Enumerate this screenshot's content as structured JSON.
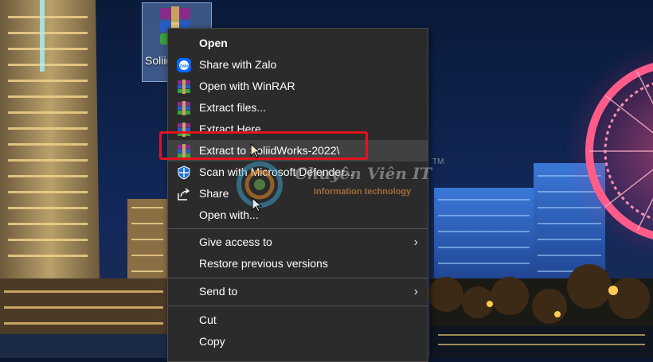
{
  "desktop": {
    "file_icon": {
      "name": "Soliid",
      "icon": "winrar-archive-icon"
    }
  },
  "context_menu": {
    "items": [
      {
        "label": "Open",
        "icon": "none",
        "bold": true
      },
      {
        "label": "Share with Zalo",
        "icon": "zalo-icon"
      },
      {
        "label": "Open with WinRAR",
        "icon": "winrar-icon"
      },
      {
        "label": "Extract files...",
        "icon": "winrar-icon"
      },
      {
        "label": "Extract Here",
        "icon": "winrar-icon"
      },
      {
        "label": "Extract to SoliidWorks-2022\\",
        "icon": "winrar-icon",
        "highlighted": true
      },
      {
        "label": "Scan with Microsoft Defender...",
        "icon": "defender-shield-icon"
      },
      {
        "label": "Share",
        "icon": "share-icon"
      },
      {
        "label": "Open with...",
        "icon": "none"
      },
      {
        "label": "Give access to",
        "icon": "none",
        "submenu": true
      },
      {
        "label": "Restore previous versions",
        "icon": "none"
      },
      {
        "label": "Send to",
        "icon": "none",
        "submenu": true
      },
      {
        "label": "Cut",
        "icon": "none"
      },
      {
        "label": "Copy",
        "icon": "none"
      }
    ],
    "submenu_glyph": "›"
  },
  "watermark": {
    "title": "Chuyên Viên IT",
    "trademark": "TM",
    "subtitle": "Information technology"
  },
  "colors": {
    "menu_bg": "#2b2b2b",
    "highlight_border": "#e0141d",
    "menu_text": "#ffffff"
  }
}
